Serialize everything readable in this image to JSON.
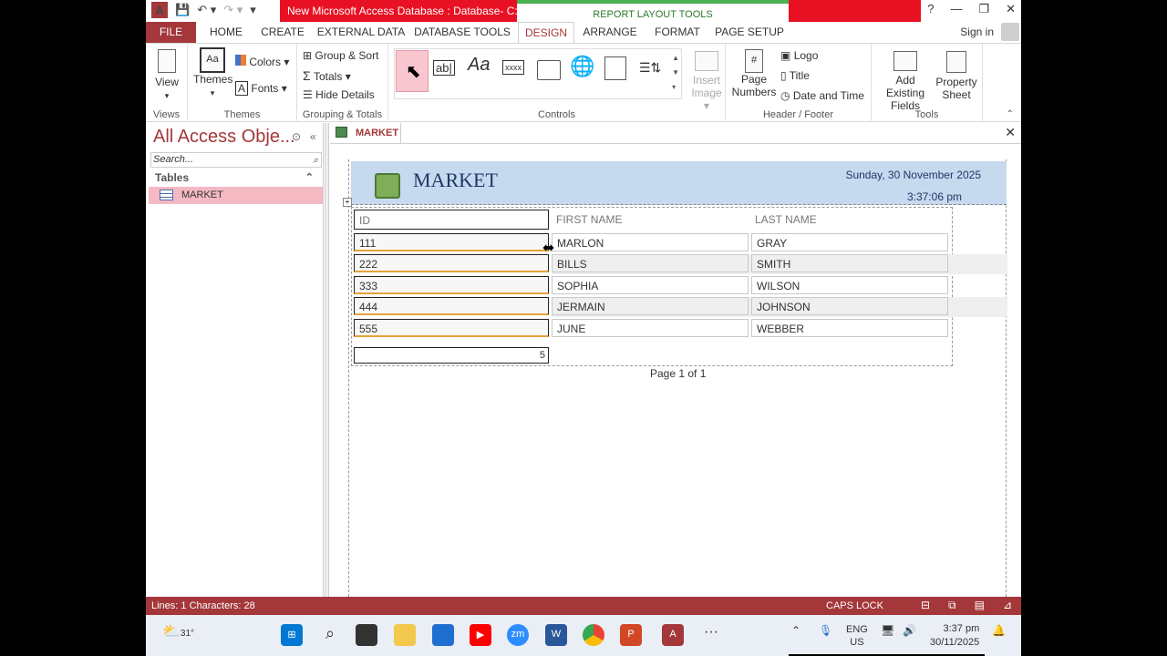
{
  "window": {
    "app_logo": "A",
    "doc_title": "New Microsoft Access Database : Database- C:...",
    "context_tab_title": "REPORT LAYOUT TOOLS",
    "help": "?",
    "min": "—",
    "restore": "❐",
    "close": "✕"
  },
  "tabs": [
    "FILE",
    "HOME",
    "CREATE",
    "EXTERNAL DATA",
    "DATABASE TOOLS",
    "DESIGN",
    "ARRANGE",
    "FORMAT",
    "PAGE SETUP"
  ],
  "active_tab": "DESIGN",
  "signin": "Sign in",
  "ribbon": {
    "views": {
      "view": "View",
      "label": "Views"
    },
    "themes": {
      "themes": "Themes",
      "colors": "Colors",
      "fonts": "Fonts",
      "label": "Themes"
    },
    "grouping": {
      "group_sort": "Group & Sort",
      "totals": "Totals",
      "hide_details": "Hide Details",
      "label": "Grouping & Totals"
    },
    "controls": {
      "label": "Controls",
      "textbox": "ab|",
      "label_ctrl": "Aa",
      "button": "xxxx"
    },
    "insert_image": {
      "line1": "Insert",
      "line2": "Image"
    },
    "header_footer": {
      "page_numbers_1": "Page",
      "page_numbers_2": "Numbers",
      "logo": "Logo",
      "title": "Title",
      "date_time": "Date and Time",
      "label": "Header / Footer"
    },
    "tools": {
      "add_fields_1": "Add Existing",
      "add_fields_2": "Fields",
      "property_1": "Property",
      "property_2": "Sheet",
      "label": "Tools"
    }
  },
  "nav": {
    "title": "All Access Obje...",
    "search_placeholder": "Search...",
    "section": "Tables",
    "items": [
      {
        "label": "MARKET"
      }
    ]
  },
  "document": {
    "tab": "MARKET",
    "report": {
      "title": "MARKET",
      "date": "Sunday, 30 November 2025",
      "time": "3:37:06 pm",
      "columns": [
        "ID",
        "FIRST NAME",
        "LAST NAME"
      ],
      "rows": [
        [
          "111",
          "MARLON",
          "GRAY"
        ],
        [
          "222",
          "BILLS",
          "SMITH"
        ],
        [
          "333",
          "SOPHIA",
          "WILSON"
        ],
        [
          "444",
          "JERMAIN",
          "JOHNSON"
        ],
        [
          "555",
          "JUNE",
          "WEBBER"
        ]
      ],
      "total": "5",
      "page": "Page 1 of 1"
    }
  },
  "status": {
    "left": "Lines: 1  Characters: 28",
    "caps": "CAPS LOCK"
  },
  "taskbar": {
    "weather": "31°",
    "lang_1": "ENG",
    "lang_2": "US",
    "time": "3:37 pm",
    "date": "30/11/2025"
  }
}
